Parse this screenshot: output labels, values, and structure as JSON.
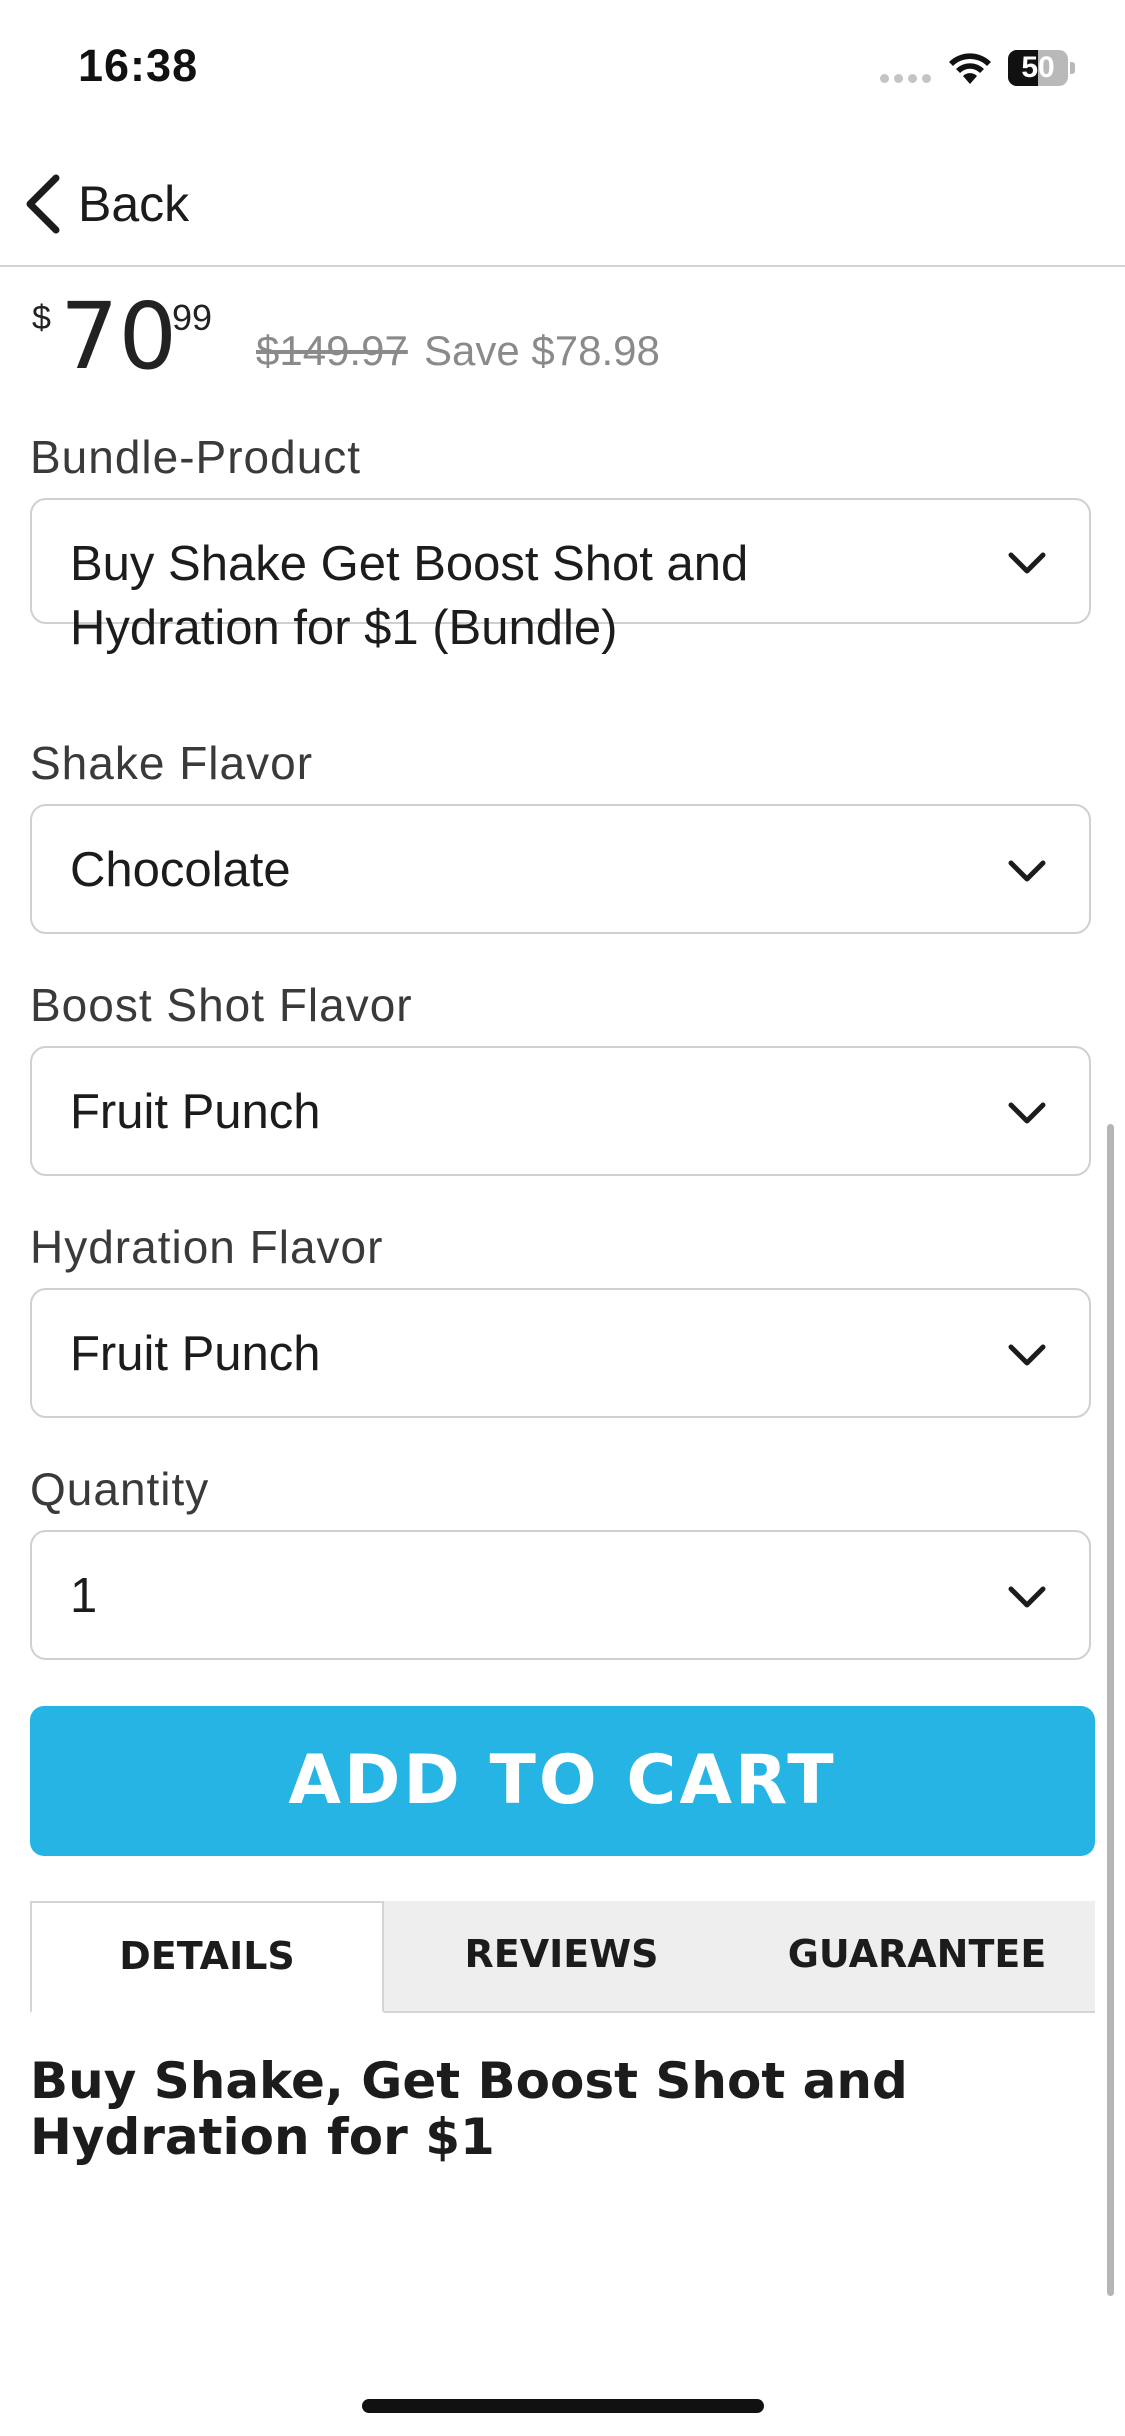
{
  "status_bar": {
    "time": "16:38",
    "battery_level": "50",
    "battery_fraction": 0.5
  },
  "nav": {
    "back_label": "Back"
  },
  "price": {
    "currency": "$",
    "main": "70",
    "cents": "99",
    "original": "$149.97",
    "save": "Save $78.98"
  },
  "fields": [
    {
      "label": "Bundle-Product",
      "value": "Buy Shake Get Boost Shot and Hydration for $1 (Bundle)"
    },
    {
      "label": "Shake Flavor",
      "value": "Chocolate"
    },
    {
      "label": "Boost Shot Flavor",
      "value": "Fruit Punch"
    },
    {
      "label": "Hydration Flavor",
      "value": "Fruit Punch"
    },
    {
      "label": "Quantity",
      "value": "1"
    }
  ],
  "add_to_cart_label": "ADD TO CART",
  "tabs": [
    {
      "label": "DETAILS",
      "active": true
    },
    {
      "label": "REVIEWS",
      "active": false
    },
    {
      "label": "GUARANTEE",
      "active": false
    }
  ],
  "description": {
    "title": "Buy Shake, Get Boost Shot and Hydration for $1"
  },
  "colors": {
    "accent": "#25b4e3",
    "text": "#1c1c1c",
    "muted": "#8a8a8a",
    "border": "#d0d0d0",
    "tab_inactive_bg": "#eeeeee"
  },
  "icons": {
    "back": "chevron-left-icon",
    "select": "chevron-down-icon",
    "wifi": "wifi-icon",
    "battery": "battery-icon",
    "signal": "signal-dots-icon"
  }
}
